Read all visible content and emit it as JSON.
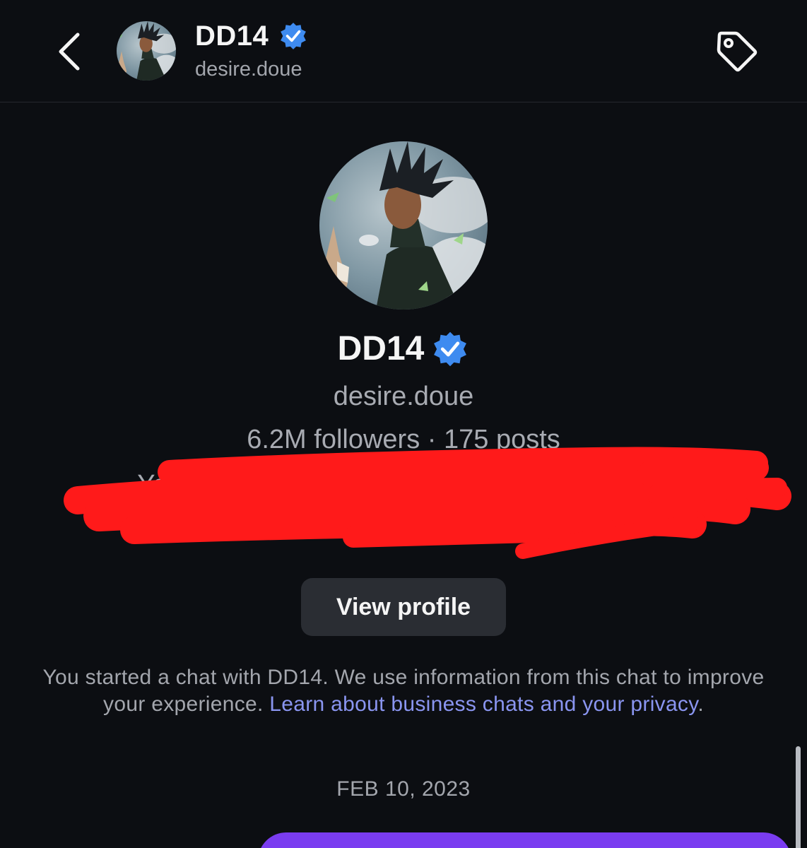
{
  "header": {
    "name": "DD14",
    "username": "desire.doue",
    "icons": {
      "back": "chevron-left-icon",
      "verified": "verified-badge-icon",
      "tag": "tag-icon"
    }
  },
  "profile": {
    "name": "DD14",
    "username": "desire.doue",
    "stats": "6.2M followers · 175 posts",
    "notice_line1": "You've followed this Instagram account since",
    "notice_line2": "",
    "view_profile_label": "View profile"
  },
  "info": {
    "text": "You started a chat with DD14. We use information from this chat to improve your experience. ",
    "link": "Learn about business chats and your privacy",
    "end": "."
  },
  "thread": {
    "date": "FEB 10, 2023"
  },
  "colors": {
    "background": "#0c0e12",
    "verified": "#3e8bf0",
    "link": "#8a95f0",
    "bubble": "#7a3cf0",
    "redaction": "#ff1a1a"
  }
}
